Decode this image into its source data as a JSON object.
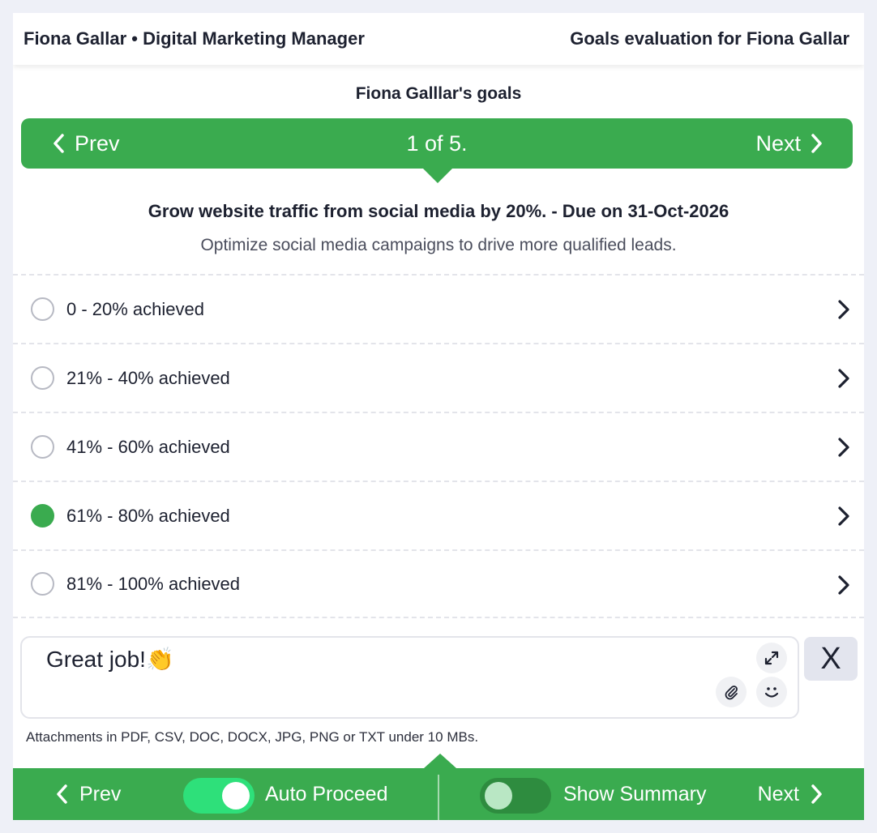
{
  "header": {
    "left": "Fiona Gallar • Digital Marketing Manager",
    "right": "Goals evaluation for Fiona Gallar"
  },
  "goals_heading": "Fiona Galllar's goals",
  "pager": {
    "prev_label": "Prev",
    "count": "1 of 5.",
    "next_label": "Next"
  },
  "goal": {
    "title": "Grow website traffic from social media by 20%. - Due on 31-Oct-2026",
    "description": "Optimize social media campaigns to drive more qualified leads."
  },
  "options": [
    {
      "label": "0 - 20% achieved",
      "selected": false
    },
    {
      "label": "21% - 40% achieved",
      "selected": false
    },
    {
      "label": "41% - 60% achieved",
      "selected": false
    },
    {
      "label": "61% - 80% achieved",
      "selected": true
    },
    {
      "label": "81% - 100% achieved",
      "selected": false
    }
  ],
  "comment": {
    "text": "Great job!👏",
    "close_label": "X",
    "attachment_note": "Attachments in PDF, CSV, DOC, DOCX, JPG, PNG or TXT under 10 MBs."
  },
  "bottom_bar": {
    "prev_label": "Prev",
    "auto_proceed_label": "Auto Proceed",
    "auto_proceed_on": true,
    "show_summary_label": "Show Summary",
    "show_summary_on": false,
    "next_label": "Next"
  },
  "colors": {
    "accent_green": "#3aab4f",
    "toggle_on": "#2ee07a",
    "toggle_off": "#2e8c3f"
  }
}
